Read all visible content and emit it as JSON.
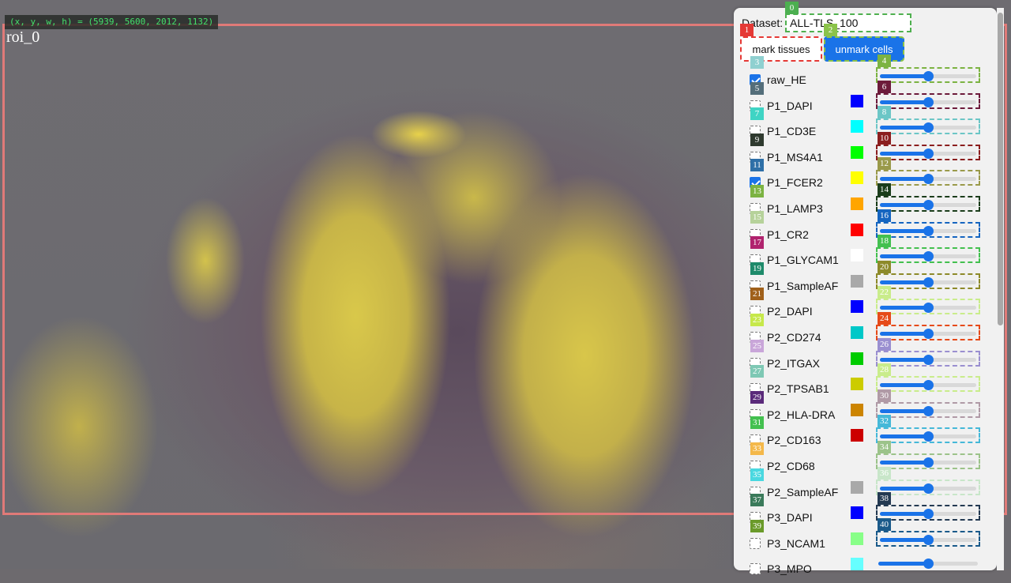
{
  "viewer": {
    "coords_text": "(x, y, w, h) = (5939, 5600, 2012, 1132)",
    "roi_label": "roi_0"
  },
  "panel": {
    "dataset_label": "Dataset:",
    "dataset_value": "ALL-TLS_100",
    "mark_tissues_label": "mark tissues",
    "unmark_cells_label": "unmark cells",
    "top_badges": [
      {
        "num": "0",
        "color": "#4caf50"
      },
      {
        "num": "1",
        "color": "#e53935"
      },
      {
        "num": "2",
        "color": "#8bc34a"
      }
    ],
    "channels": [
      {
        "name": "raw_HE",
        "checked": true,
        "swatch": "",
        "cb_badge": "3",
        "cb_badge_color": "#8fd0d0",
        "sl_badge": "4",
        "sl_badge_color": "#7cb342",
        "sl_border": "#7cb342",
        "value": 0.5
      },
      {
        "name": "P1_DAPI",
        "checked": false,
        "swatch": "#0000ff",
        "cb_badge": "5",
        "cb_badge_color": "#546e7a",
        "sl_badge": "6",
        "sl_badge_color": "#6d1b3b",
        "sl_border": "#6d1b3b",
        "value": 0.5
      },
      {
        "name": "P1_CD3E",
        "checked": false,
        "swatch": "#00ffff",
        "cb_badge": "7",
        "cb_badge_color": "#3fd4c4",
        "sl_badge": "8",
        "sl_badge_color": "#6cc6c6",
        "sl_border": "#6cc6c6",
        "value": 0.5
      },
      {
        "name": "P1_MS4A1",
        "checked": false,
        "swatch": "#00ff00",
        "cb_badge": "9",
        "cb_badge_color": "#2f3a2f",
        "sl_badge": "10",
        "sl_badge_color": "#8b1e1e",
        "sl_border": "#8b1e1e",
        "value": 0.5
      },
      {
        "name": "P1_FCER2",
        "checked": true,
        "swatch": "#ffff00",
        "cb_badge": "11",
        "cb_badge_color": "#2e6fa7",
        "sl_badge": "12",
        "sl_badge_color": "#9a9a4a",
        "sl_border": "#9a9a4a",
        "value": 0.5
      },
      {
        "name": "P1_LAMP3",
        "checked": false,
        "swatch": "#ffa500",
        "cb_badge": "13",
        "cb_badge_color": "#7cb342",
        "sl_badge": "14",
        "sl_badge_color": "#1b3d1b",
        "sl_border": "#1b3d1b",
        "value": 0.5
      },
      {
        "name": "P1_CR2",
        "checked": false,
        "swatch": "#ff0000",
        "cb_badge": "15",
        "cb_badge_color": "#b6d29a",
        "sl_badge": "16",
        "sl_badge_color": "#1565c0",
        "sl_border": "#1565c0",
        "value": 0.5
      },
      {
        "name": "P1_GLYCAM1",
        "checked": false,
        "swatch": "#ffffff",
        "cb_badge": "17",
        "cb_badge_color": "#b0236e",
        "sl_badge": "18",
        "sl_badge_color": "#43c04f",
        "sl_border": "#43c04f",
        "value": 0.5
      },
      {
        "name": "P1_SampleAF",
        "checked": false,
        "swatch": "#a9a9a9",
        "cb_badge": "19",
        "cb_badge_color": "#1e8a6a",
        "sl_badge": "20",
        "sl_badge_color": "#8d8a2a",
        "sl_border": "#8d8a2a",
        "value": 0.5
      },
      {
        "name": "P2_DAPI",
        "checked": false,
        "swatch": "#0000ff",
        "cb_badge": "21",
        "cb_badge_color": "#a0601a",
        "sl_badge": "22",
        "sl_badge_color": "#c9ec8b",
        "sl_border": "#c9ec8b",
        "value": 0.5
      },
      {
        "name": "P2_CD274",
        "checked": false,
        "swatch": "#00c8c8",
        "cb_badge": "23",
        "cb_badge_color": "#c6e84a",
        "sl_badge": "24",
        "sl_badge_color": "#e64a19",
        "sl_border": "#e64a19",
        "value": 0.5
      },
      {
        "name": "P2_ITGAX",
        "checked": false,
        "swatch": "#00cc00",
        "cb_badge": "25",
        "cb_badge_color": "#c9a6d9",
        "sl_badge": "26",
        "sl_badge_color": "#9a8fd0",
        "sl_border": "#9a8fd0",
        "value": 0.5
      },
      {
        "name": "P2_TPSAB1",
        "checked": false,
        "swatch": "#cccc00",
        "cb_badge": "27",
        "cb_badge_color": "#7ec8b4",
        "sl_badge": "28",
        "sl_badge_color": "#c9ec8b",
        "sl_border": "#c9ec8b",
        "value": 0.5
      },
      {
        "name": "P2_HLA-DRA",
        "checked": false,
        "swatch": "#cc8400",
        "cb_badge": "29",
        "cb_badge_color": "#5a2a7a",
        "sl_badge": "30",
        "sl_badge_color": "#b09aa6",
        "sl_border": "#b09aa6",
        "value": 0.5
      },
      {
        "name": "P2_CD163",
        "checked": false,
        "swatch": "#cc0000",
        "cb_badge": "31",
        "cb_badge_color": "#43c04f",
        "sl_badge": "32",
        "sl_badge_color": "#45b8d8",
        "sl_border": "#45b8d8",
        "value": 0.5
      },
      {
        "name": "P2_CD68",
        "checked": false,
        "swatch": "",
        "cb_badge": "33",
        "cb_badge_color": "#f4b84a",
        "sl_badge": "34",
        "sl_badge_color": "#9cc38a",
        "sl_border": "#9cc38a",
        "value": 0.5
      },
      {
        "name": "P2_SampleAF",
        "checked": false,
        "swatch": "#a9a9a9",
        "cb_badge": "35",
        "cb_badge_color": "#4ad8e0",
        "sl_badge": "36",
        "sl_badge_color": "#c8e6c9",
        "sl_border": "#c8e6c9",
        "value": 0.5
      },
      {
        "name": "P3_DAPI",
        "checked": false,
        "swatch": "#0000ff",
        "cb_badge": "37",
        "cb_badge_color": "#3a7a5a",
        "sl_badge": "38",
        "sl_badge_color": "#243a52",
        "sl_border": "#243a52",
        "value": 0.5
      },
      {
        "name": "P3_NCAM1",
        "checked": false,
        "swatch": "#88ff88",
        "cb_badge": "39",
        "cb_badge_color": "#6a9a2a",
        "sl_badge": "40",
        "sl_badge_color": "#1a5a8a",
        "sl_border": "#1a5a8a",
        "value": 0.5
      },
      {
        "name": "P3_MPO",
        "checked": false,
        "swatch": "#66ffff",
        "cb_badge": "",
        "cb_badge_color": "",
        "sl_badge": "",
        "sl_badge_color": "",
        "sl_border": "",
        "value": 0.5
      }
    ]
  }
}
